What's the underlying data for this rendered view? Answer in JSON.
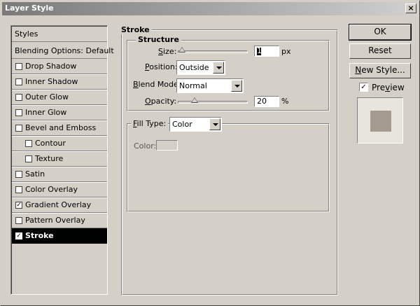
{
  "window": {
    "title": "Layer Style",
    "close_glyph": "×"
  },
  "styles_list": {
    "header": "Styles",
    "blending": "Blending Options: Default",
    "items": [
      {
        "label": "Drop Shadow",
        "checked": false,
        "sub": false
      },
      {
        "label": "Inner Shadow",
        "checked": false,
        "sub": false
      },
      {
        "label": "Outer Glow",
        "checked": false,
        "sub": false
      },
      {
        "label": "Inner Glow",
        "checked": false,
        "sub": false
      },
      {
        "label": "Bevel and Emboss",
        "checked": false,
        "sub": false
      },
      {
        "label": "Contour",
        "checked": false,
        "sub": true
      },
      {
        "label": "Texture",
        "checked": false,
        "sub": true
      },
      {
        "label": "Satin",
        "checked": false,
        "sub": false
      },
      {
        "label": "Color Overlay",
        "checked": false,
        "sub": false
      },
      {
        "label": "Gradient Overlay",
        "checked": true,
        "sub": false
      },
      {
        "label": "Pattern Overlay",
        "checked": false,
        "sub": false
      },
      {
        "label": "Stroke",
        "checked": true,
        "sub": false,
        "selected": true
      }
    ]
  },
  "stroke": {
    "group_title": "Stroke",
    "structure_title": "Structure",
    "size_label": "Size:",
    "size_value": "1",
    "size_unit": "px",
    "size_slider_fraction": 0.0,
    "position_label": "Position:",
    "position_value": "Outside",
    "blend_mode_label": "Blend Mode:",
    "blend_mode_value": "Normal",
    "opacity_label": "Opacity:",
    "opacity_value": "20",
    "opacity_unit": "%",
    "opacity_slider_fraction": 0.2,
    "fill_type_label": "Fill Type:",
    "fill_type_value": "Color",
    "color_label": "Color:",
    "color_value": "#d4d0c8"
  },
  "buttons": {
    "ok": "OK",
    "reset": "Reset",
    "new_style": "New Style...",
    "preview_label": "Preview",
    "preview_checked": true
  },
  "check_glyph": "✓",
  "colors": {
    "preview_swatch": "#a49a90",
    "selected_bg": "#000000"
  }
}
